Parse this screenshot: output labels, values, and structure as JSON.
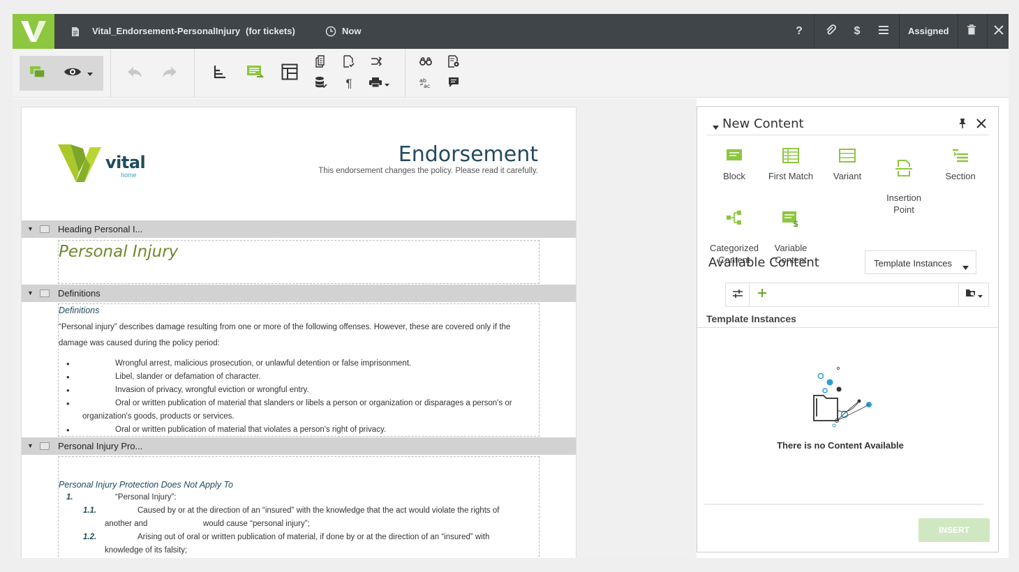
{
  "titlebar": {
    "document_name": "Vital_Endorsement-PersonalInjury",
    "document_suffix": "(for tickets)",
    "time_label": "Now",
    "help_label": "?",
    "pricing_label": "$",
    "status_label": "Assigned"
  },
  "document": {
    "header": {
      "logo_word": "vital",
      "logo_sub": "home",
      "title": "Endorsement",
      "subtitle": "This endorsement changes the policy. Please read it carefully."
    },
    "sections": [
      {
        "label": "Heading Personal I..."
      },
      {
        "label": "Definitions"
      },
      {
        "label": "Personal Injury Pro..."
      }
    ],
    "heading_text": "Personal Injury",
    "definitions": {
      "title": "Definitions",
      "para_line1": "“Personal injury” describes damage resulting from one or more of the following offenses. However, these are covered only if the",
      "para_line2": "damage was caused during the policy period:",
      "bullets": [
        "Wrongful arrest, malicious prosecution, or unlawful detention or false imprisonment.",
        "Libel, slander or defamation of character.",
        "Invasion of privacy, wrongful eviction or wrongful entry.",
        "Oral or written publication of material that slanders or libels a person or organization or disparages a person's or",
        "Oral or written publication of material that violates a person's right of privacy."
      ],
      "bullet4_cont": "organization's goods, products or services."
    },
    "protection": {
      "title": "Personal Injury Protection Does Not Apply To",
      "item1_num": "1.",
      "item1_text": "“Personal Injury”:",
      "item11_num": "1.1.",
      "item11_line1": "Caused by or at the direction of an “insured” with the knowledge that the act would violate the rights of",
      "item11_line2a": "another and",
      "item11_line2b": "would cause “personal injury”;",
      "item12_num": "1.2.",
      "item12_line1": "Arising out of oral or written publication of material, if done by or at the direction of an “insured” with",
      "item12_line2": "knowledge of its falsity;"
    }
  },
  "panel": {
    "title": "New Content",
    "items": [
      {
        "label": "Block"
      },
      {
        "label": "First Match"
      },
      {
        "label": "Variant"
      },
      {
        "label": "Insertion\nPoint"
      },
      {
        "label": "Section"
      },
      {
        "label": "Categorized\nContent"
      },
      {
        "label": "Variable\nContent"
      }
    ],
    "available_title": "Available Content",
    "dropdown_value": "Template Instances",
    "list_title": "Template Instances",
    "empty_message": "There is no Content Available",
    "insert_label": "INSERT"
  },
  "colors": {
    "brand_green": "#8dc63f",
    "titlebar_bg": "#3f4549",
    "heading_green": "#6b8a2a",
    "link_blue": "#234a5e"
  }
}
